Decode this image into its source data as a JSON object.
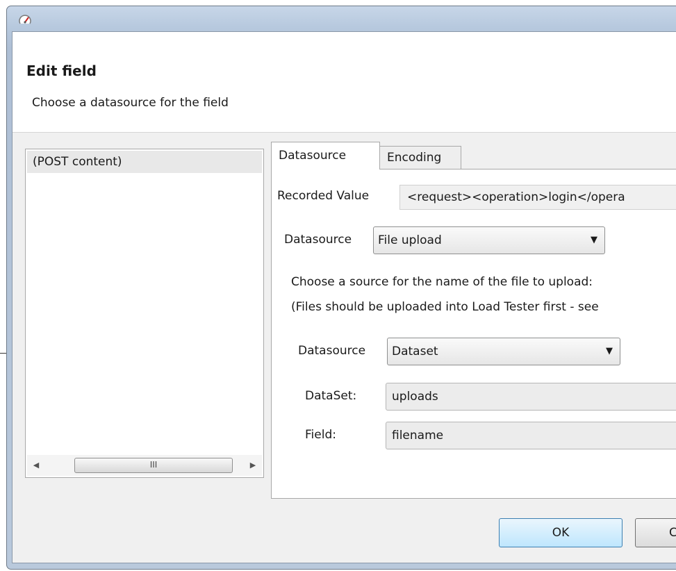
{
  "dialog": {
    "title": "Edit field",
    "subtitle": "Choose a datasource for the field"
  },
  "left_list": {
    "items": [
      "(POST content)"
    ],
    "scroll_thumb_grip": "III"
  },
  "tabs": [
    {
      "label": "Datasource",
      "active": true
    },
    {
      "label": "Encoding",
      "active": false
    }
  ],
  "datasource_tab": {
    "recorded_value_label": "Recorded Value",
    "recorded_value": "<request><operation>login</opera",
    "datasource_label": "Datasource",
    "datasource_value": "File upload",
    "instruction_line1": "Choose a source for the name of the file to upload:",
    "instruction_line2": "(Files should be uploaded into Load Tester first - see",
    "sub_datasource_label": "Datasource",
    "sub_datasource_value": "Dataset",
    "dataset_label": "DataSet:",
    "dataset_value": "uploads",
    "field_label": "Field:",
    "field_value": "filename"
  },
  "buttons": {
    "ok": "OK",
    "cancel": "C"
  },
  "icons": {
    "app": "speedometer-icon",
    "dropdown": "chevron-down-icon",
    "scroll_left": "scroll-left-arrow-icon",
    "scroll_right": "scroll-right-arrow-icon"
  },
  "colors": {
    "title_gradient": "#b7c9de",
    "ok_button": "#bee6fd",
    "ok_border": "#3c7fb1"
  }
}
